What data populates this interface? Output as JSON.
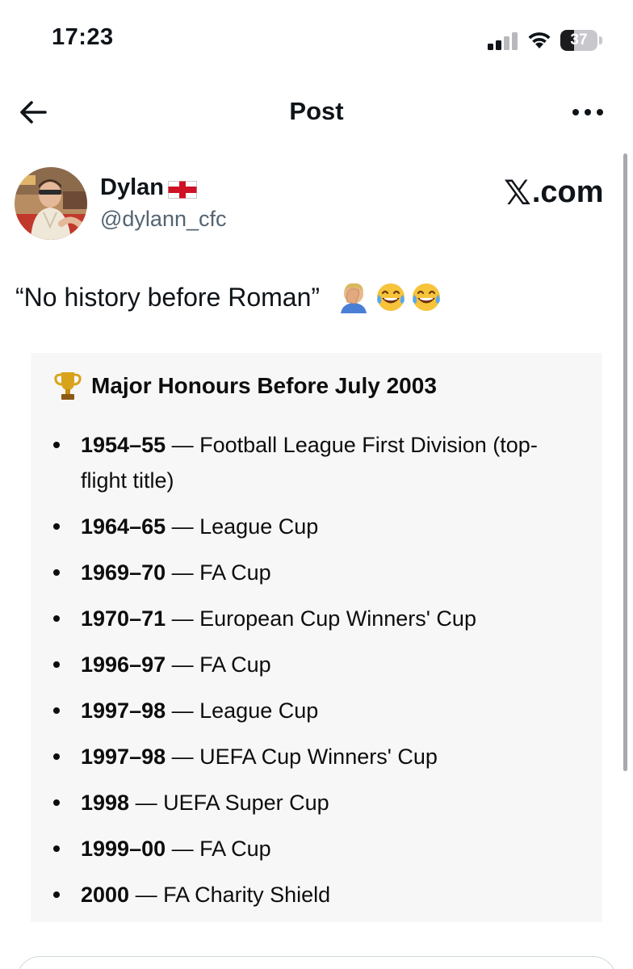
{
  "status_bar": {
    "time": "17:23",
    "battery_percent": 37,
    "battery_label": "37",
    "signal_bars_active": 2,
    "signal_bars_total": 4
  },
  "nav": {
    "title": "Post",
    "back_icon": "arrow-left-icon",
    "more_icon": "more-horizontal-icon"
  },
  "author": {
    "name": "Dylan",
    "flag_icon": "england-flag-icon",
    "handle": "@dylann_cfc"
  },
  "watermark": {
    "logo": "𝕏",
    "text": ".com"
  },
  "post": {
    "text": "“No history before Roman”",
    "emojis": [
      "facepalm-emoji",
      "laughing-emoji",
      "laughing-emoji"
    ]
  },
  "card": {
    "icon": "trophy-icon",
    "title": "Major Honours Before July 2003",
    "honours": [
      {
        "season": "1954–55",
        "text": " — Football League First Division (top-flight title)"
      },
      {
        "season": "1964–65",
        "text": " — League Cup"
      },
      {
        "season": "1969–70",
        "text": " — FA Cup"
      },
      {
        "season": "1970–71",
        "text": " — European Cup Winners' Cup"
      },
      {
        "season": "1996–97",
        "text": " — FA Cup"
      },
      {
        "season": "1997–98",
        "text": " — League Cup"
      },
      {
        "season": "1997–98",
        "text": " — UEFA Cup Winners' Cup"
      },
      {
        "season": "1998",
        "text": " — UEFA Super Cup"
      },
      {
        "season": "1999–00",
        "text": " — FA Cup"
      },
      {
        "season": "2000",
        "text": " — FA Charity Shield"
      }
    ]
  },
  "colors": {
    "text": "#0f1419",
    "secondary": "#536471",
    "card_bg": "#f7f7f7"
  }
}
